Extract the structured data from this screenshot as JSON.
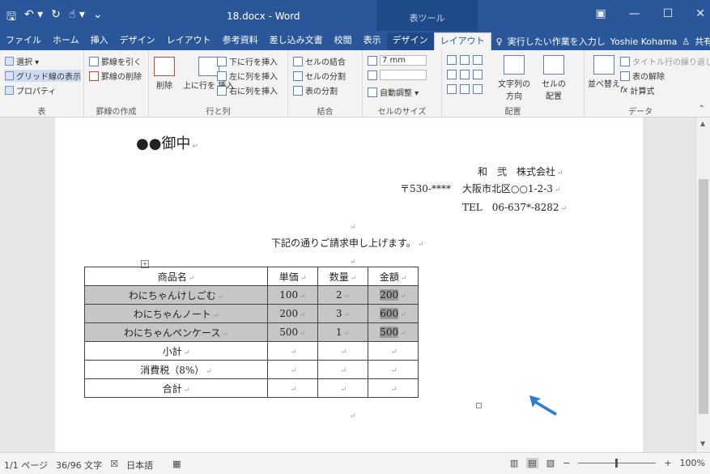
{
  "titlebar": {
    "title": "18.docx - Word",
    "tool_context": "表ツール",
    "qat": [
      "save-icon",
      "undo-icon",
      "redo-icon",
      "touch-icon",
      "customize-icon"
    ],
    "controls": [
      "ribbon-display-icon",
      "minimize-icon",
      "maximize-icon",
      "close-icon"
    ]
  },
  "tabs": [
    "ファイル",
    "ホーム",
    "挿入",
    "デザイン",
    "レイアウト",
    "参考資料",
    "差し込み文書",
    "校閲",
    "表示",
    "デザイン",
    "レイアウト"
  ],
  "tell_me": "実行したい作業を入力し",
  "user": "Yoshie Kohama",
  "share": "共有",
  "ribbon": {
    "table": {
      "select": "選択 ▾",
      "gridlines": "グリッド線の表示",
      "properties": "プロパティ",
      "label": "表"
    },
    "draw": {
      "draw": "罫線を引く",
      "erase": "罫線の削除",
      "label": "罫線の作成"
    },
    "rows": {
      "delete": "削除",
      "insert_above": "上に行を 挿入",
      "insert_below": "下に行を挿入",
      "insert_left": "左に列を挿入",
      "insert_right": "右に列を挿入",
      "label": "行と列"
    },
    "merge": {
      "merge": "セルの結合",
      "split": "セルの分割",
      "split_table": "表の分割",
      "label": "結合"
    },
    "size": {
      "height": "7 mm",
      "autofit": "自動調整 ▾",
      "label": "セルのサイズ"
    },
    "align": {
      "direction": "文字列の 方向",
      "margins": "セルの 配置",
      "label": "配置"
    },
    "data": {
      "sort": "並べ替え",
      "repeat": "タイトル行の繰り返し",
      "convert": "表の解除",
      "formula": "計算式",
      "label": "データ"
    }
  },
  "document": {
    "addressee": "●●御中",
    "company": "和　弐　株式会社",
    "postal": "〒530-****",
    "address": "大阪市北区○○1-2-3",
    "tel": "TEL　06-637*-8282",
    "intro": "下記の通りご請求申し上げます。",
    "table": {
      "headers": [
        "商品名",
        "単価",
        "数量",
        "金額"
      ],
      "rows": [
        [
          "わにちゃんけしごむ",
          "100",
          "2",
          "200"
        ],
        [
          "わにちゃんノート",
          "200",
          "3",
          "600"
        ],
        [
          "わにちゃんペンケース",
          "500",
          "1",
          "500"
        ]
      ],
      "summary": [
        "小計",
        "消費税（8%）",
        "合計"
      ]
    }
  },
  "status": {
    "pages": "1/1 ページ",
    "words": "36/96 文字",
    "lang": "日本語",
    "zoom": "100%"
  },
  "colors": {
    "accent": "#2b579a",
    "selection": "#c6c6c6"
  }
}
